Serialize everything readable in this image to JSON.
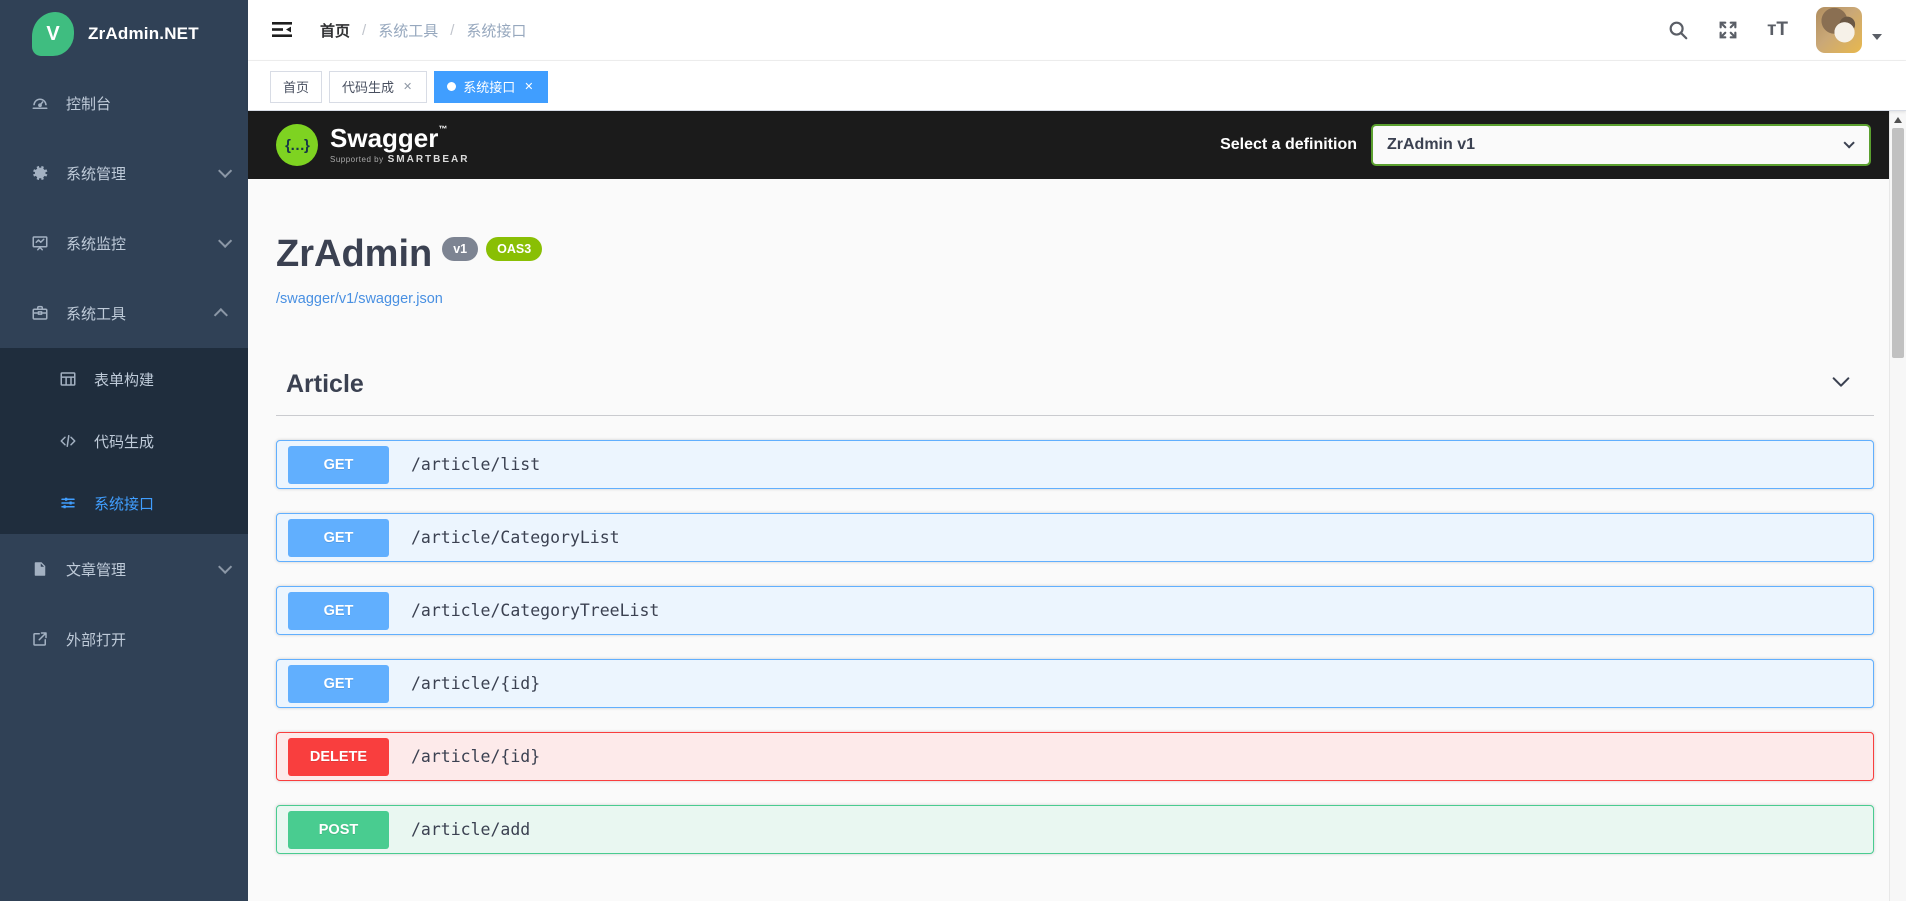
{
  "app_title": "ZrAdmin.NET",
  "icons": {
    "close": "✕",
    "braces": "{…}",
    "font_size": "тT"
  },
  "sidebar": {
    "logo_letter": "V",
    "logo_text": "ZrAdmin.NET",
    "items": [
      {
        "label": "控制台"
      },
      {
        "label": "系统管理"
      },
      {
        "label": "系统监控"
      },
      {
        "label": "系统工具"
      },
      {
        "label": "表单构建"
      },
      {
        "label": "代码生成"
      },
      {
        "label": "系统接口"
      },
      {
        "label": "文章管理"
      },
      {
        "label": "外部打开"
      }
    ]
  },
  "navbar": {
    "breadcrumb": {
      "items": [
        "首页",
        "系统工具",
        "系统接口"
      ],
      "separator": "/"
    }
  },
  "tabs": [
    {
      "label": "首页"
    },
    {
      "label": "代码生成"
    },
    {
      "label": "系统接口"
    }
  ],
  "swagger": {
    "topbar": {
      "logo_text": "Swagger",
      "trademark": "™",
      "supported_by": "Supported by",
      "smartbear": "SMARTBEAR",
      "select_label": "Select a definition",
      "select_value": "ZrAdmin v1"
    },
    "info": {
      "title": "ZrAdmin",
      "version_badge": "v1",
      "oas_badge": "OAS3",
      "spec_link": "/swagger/v1/swagger.json"
    },
    "section_title": "Article",
    "endpoints": [
      {
        "method": "GET",
        "path": "/article/list"
      },
      {
        "method": "GET",
        "path": "/article/CategoryList"
      },
      {
        "method": "GET",
        "path": "/article/CategoryTreeList"
      },
      {
        "method": "GET",
        "path": "/article/{id}"
      },
      {
        "method": "DELETE",
        "path": "/article/{id}"
      },
      {
        "method": "POST",
        "path": "/article/add"
      }
    ],
    "colors": {
      "get": "#61affe",
      "post": "#49cc90",
      "delete": "#f93e3e",
      "oas_green": "#89bf04",
      "topbar_bg": "#1b1b1b",
      "accent_blue": "#409eff",
      "sidebar_bg": "#304156"
    }
  }
}
